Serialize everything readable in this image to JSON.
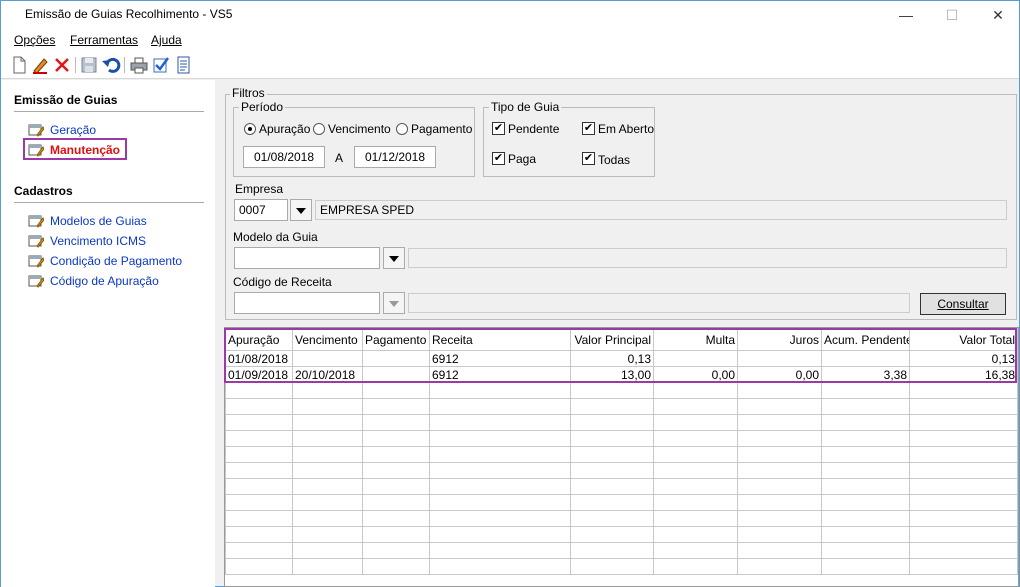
{
  "window": {
    "title": "Emissão de Guias Recolhimento - VS5",
    "minimize": "—",
    "maximize": "☐",
    "close": "✕"
  },
  "menu": {
    "items": [
      "Opções",
      "Ferramentas",
      "Ajuda"
    ]
  },
  "toolbar": {
    "icons": [
      "new-icon",
      "edit-icon",
      "delete-icon",
      "save-icon",
      "undo-icon",
      "print-icon",
      "check-icon",
      "report-icon"
    ]
  },
  "sidebar": {
    "section1": "Emissão de Guias",
    "section1_items": [
      "Geração",
      "Manutenção"
    ],
    "section2": "Cadastros",
    "section2_items": [
      "Modelos de Guias",
      "Vencimento ICMS",
      "Condição de Pagamento",
      "Código de Apuração"
    ]
  },
  "filters": {
    "title": "Filtros",
    "period": {
      "label": "Período",
      "options": [
        "Apuração",
        "Vencimento",
        "Pagamento"
      ],
      "selected": "Apuração",
      "start": "01/08/2018",
      "separator": "A",
      "end": "01/12/2018"
    },
    "guide_type": {
      "label": "Tipo de Guia",
      "options": [
        "Pendente",
        "Em Aberto",
        "Paga",
        "Todas"
      ],
      "check": "✔"
    },
    "empresa": {
      "label": "Empresa",
      "code": "0007",
      "name": "EMPRESA SPED"
    },
    "modelo": {
      "label": "Modelo da Guia",
      "code": "",
      "name": ""
    },
    "codigo_receita": {
      "label": "Código de Receita",
      "code": "",
      "name": ""
    },
    "consultar": "Consultar"
  },
  "table": {
    "columns": [
      "Apuração",
      "Vencimento",
      "Pagamento",
      "Receita",
      "Valor Principal",
      "Multa",
      "Juros",
      "Acum. Pendente",
      "Valor Total"
    ],
    "rows": [
      [
        "01/08/2018",
        "",
        "",
        "6912",
        "0,13",
        "",
        "",
        "",
        "0,13"
      ],
      [
        "01/09/2018",
        "20/10/2018",
        "",
        "6912",
        "13,00",
        "0,00",
        "0,00",
        "3,38",
        "16,38"
      ]
    ]
  }
}
